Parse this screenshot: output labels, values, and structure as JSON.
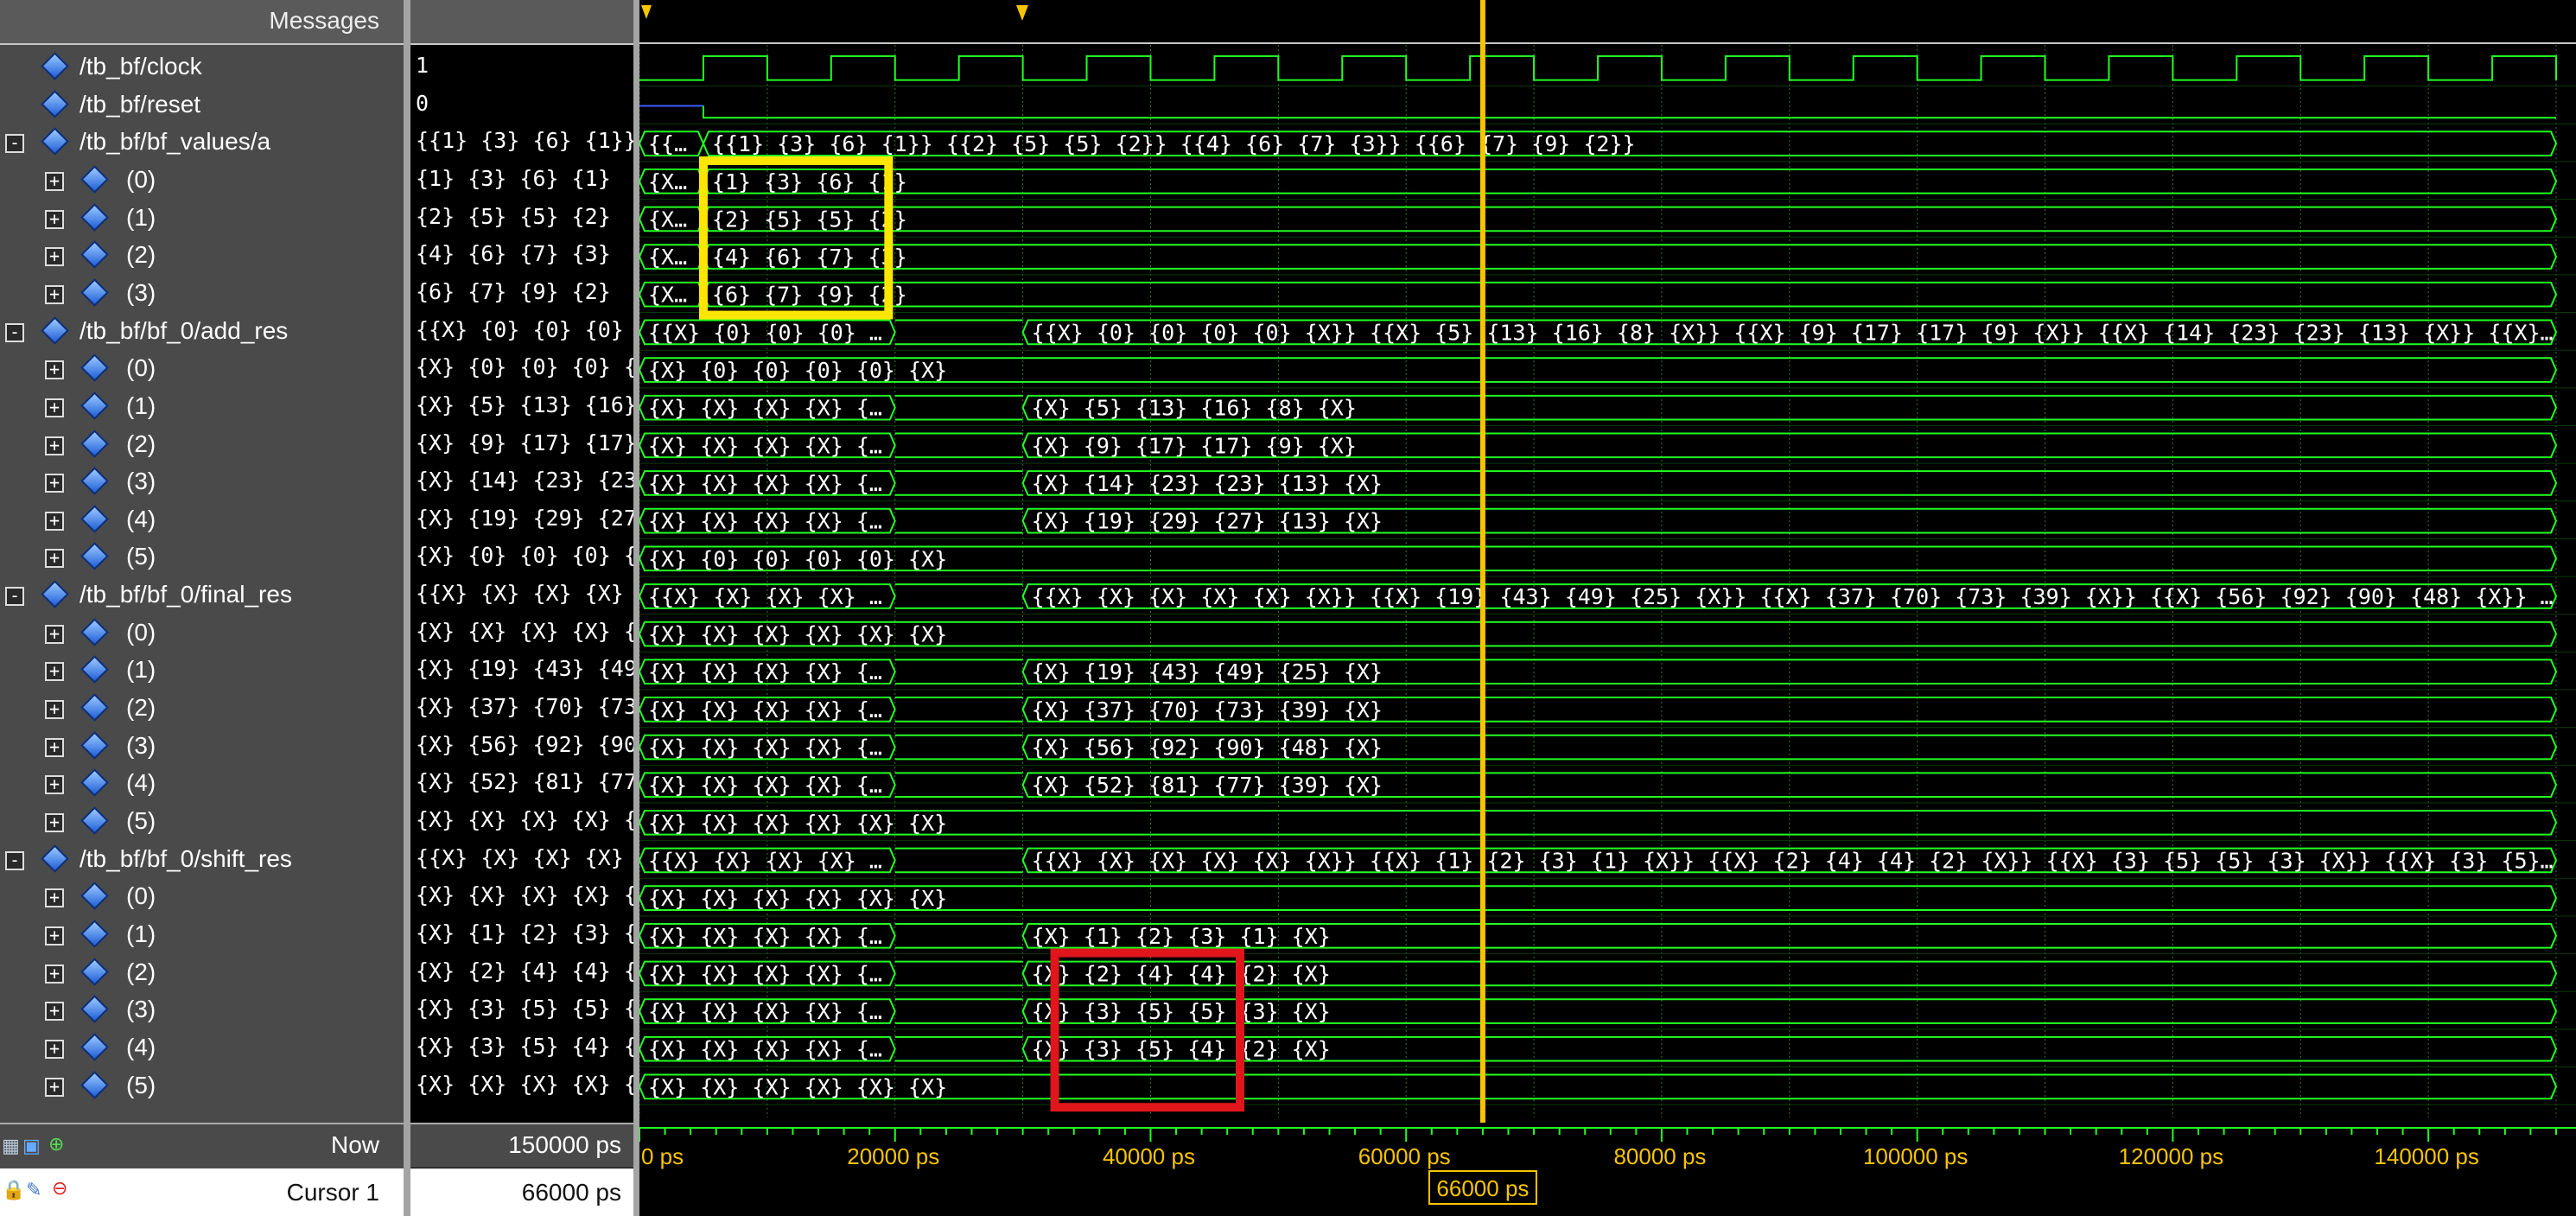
{
  "header": {
    "messages_label": "Messages"
  },
  "signals": [
    {
      "name": "/tb_bf/clock",
      "expander": "",
      "level": 0,
      "value": "1",
      "kind": "clock"
    },
    {
      "name": "/tb_bf/reset",
      "expander": "",
      "level": 0,
      "value": "0",
      "kind": "reset"
    },
    {
      "name": "/tb_bf/bf_values/a",
      "expander": "-",
      "level": 0,
      "value": "{{1} {3} {6} {1}} {{2} {5} {5} {2}} {{4} {6} {7} {3}} {{6} {7} {9} {2}}",
      "kind": "bus",
      "segments": [
        {
          "t0": 0,
          "t1": 5000,
          "text": "{{..."
        },
        {
          "t0": 5000,
          "t1": 150000,
          "text": "{{1} {3} {6} {1}} {{2} {5} {5} {2}} {{4} {6} {7} {3}} {{6} {7} {9} {2}}"
        }
      ]
    },
    {
      "name": "(0)",
      "expander": "+",
      "level": 1,
      "value": "{1} {3} {6} {1}",
      "kind": "bus",
      "segments": [
        {
          "t0": 0,
          "t1": 5000,
          "text": "{X}..."
        },
        {
          "t0": 5000,
          "t1": 150000,
          "text": "{1} {3} {6} {1}"
        }
      ]
    },
    {
      "name": "(1)",
      "expander": "+",
      "level": 1,
      "value": "{2} {5} {5} {2}",
      "kind": "bus",
      "segments": [
        {
          "t0": 0,
          "t1": 5000,
          "text": "{X}..."
        },
        {
          "t0": 5000,
          "t1": 150000,
          "text": "{2} {5} {5} {2}"
        }
      ]
    },
    {
      "name": "(2)",
      "expander": "+",
      "level": 1,
      "value": "{4} {6} {7} {3}",
      "kind": "bus",
      "segments": [
        {
          "t0": 0,
          "t1": 5000,
          "text": "{X}..."
        },
        {
          "t0": 5000,
          "t1": 150000,
          "text": "{4} {6} {7} {3}"
        }
      ]
    },
    {
      "name": "(3)",
      "expander": "+",
      "level": 1,
      "value": "{6} {7} {9} {2}",
      "kind": "bus",
      "segments": [
        {
          "t0": 0,
          "t1": 5000,
          "text": "{X}..."
        },
        {
          "t0": 5000,
          "t1": 150000,
          "text": "{6} {7} {9} {2}"
        }
      ]
    },
    {
      "name": "/tb_bf/bf_0/add_res",
      "expander": "-",
      "level": 0,
      "value": "{{X} {0} {0} {0} {0} {X}} {{X} {5} {13} {16} {8} {X}} {{X} {9} {17} {17} {9} {X}} {{X} {14} {23} {23} {13} {X}} {{X} {19} {29} {27} {13} {X}}",
      "kind": "bus",
      "segments": [
        {
          "t0": 0,
          "t1": 20000,
          "text": "{{X} {0} {0} {0} {0} {X}} {{X} {..."
        },
        {
          "t0": 30000,
          "t1": 150000,
          "text": "{{X} {0} {0} {0} {0} {X}} {{X} {5} {13} {16} {8} {X}} {{X} {9} {17} {17} {9} {X}} {{X} {14} {23} {23} {13} {X}} {{X} {19} {29} {27} {13} {..."
        }
      ]
    },
    {
      "name": "(0)",
      "expander": "+",
      "level": 1,
      "value": "{X} {0} {0} {0} {0} {X}",
      "kind": "bus",
      "segments": [
        {
          "t0": 0,
          "t1": 150000,
          "text": "{X} {0} {0} {0} {0} {X}"
        }
      ]
    },
    {
      "name": "(1)",
      "expander": "+",
      "level": 1,
      "value": "{X} {5} {13} {16} {8} {X}",
      "kind": "bus",
      "segments": [
        {
          "t0": 0,
          "t1": 20000,
          "text": "{X} {X} {X} {X} {X} {X}"
        },
        {
          "t0": 30000,
          "t1": 150000,
          "text": "{X} {5} {13} {16} {8} {X}"
        }
      ]
    },
    {
      "name": "(2)",
      "expander": "+",
      "level": 1,
      "value": "{X} {9} {17} {17} {9} {X}",
      "kind": "bus",
      "segments": [
        {
          "t0": 0,
          "t1": 20000,
          "text": "{X} {X} {X} {X} {X} {X}"
        },
        {
          "t0": 30000,
          "t1": 150000,
          "text": "{X} {9} {17} {17} {9} {X}"
        }
      ]
    },
    {
      "name": "(3)",
      "expander": "+",
      "level": 1,
      "value": "{X} {14} {23} {23} {13} {X}",
      "kind": "bus",
      "segments": [
        {
          "t0": 0,
          "t1": 20000,
          "text": "{X} {X} {X} {X} {X} {X}"
        },
        {
          "t0": 30000,
          "t1": 150000,
          "text": "{X} {14} {23} {23} {13} {X}"
        }
      ]
    },
    {
      "name": "(4)",
      "expander": "+",
      "level": 1,
      "value": "{X} {19} {29} {27} {13} {X}",
      "kind": "bus",
      "segments": [
        {
          "t0": 0,
          "t1": 20000,
          "text": "{X} {X} {X} {X} {X} {X}"
        },
        {
          "t0": 30000,
          "t1": 150000,
          "text": "{X} {19} {29} {27} {13} {X}"
        }
      ]
    },
    {
      "name": "(5)",
      "expander": "+",
      "level": 1,
      "value": "{X} {0} {0} {0} {0} {X}",
      "kind": "bus",
      "segments": [
        {
          "t0": 0,
          "t1": 150000,
          "text": "{X} {0} {0} {0} {0} {X}"
        }
      ]
    },
    {
      "name": "/tb_bf/bf_0/final_res",
      "expander": "-",
      "level": 0,
      "value": "{{X} {X} {X} {X} {X} {X}} {{X} {19} {43} {49} {25} {X}} {{X} {37} {70} {73} {39} {X}} {{X} {56} {92} {90} {48} {X}} {{X} {52} {81} {77} {39} {X}}",
      "kind": "bus",
      "segments": [
        {
          "t0": 0,
          "t1": 20000,
          "text": "{{X} {X} {X} {X} {X} {X}} {{X} {..."
        },
        {
          "t0": 30000,
          "t1": 150000,
          "text": "{{X} {X} {X} {X} {X} {X}} {{X} {19} {43} {49} {25} {X}} {{X} {37} {70} {73} {39} {X}} {{X} {56} {92} {90} {48} {X}} {{X} {52} {81} {77} {..."
        }
      ]
    },
    {
      "name": "(0)",
      "expander": "+",
      "level": 1,
      "value": "{X} {X} {X} {X} {X} {X}",
      "kind": "bus",
      "segments": [
        {
          "t0": 0,
          "t1": 150000,
          "text": "{X} {X} {X} {X} {X} {X}"
        }
      ]
    },
    {
      "name": "(1)",
      "expander": "+",
      "level": 1,
      "value": "{X} {19} {43} {49} {25} {X}",
      "kind": "bus",
      "segments": [
        {
          "t0": 0,
          "t1": 20000,
          "text": "{X} {X} {X} {X} {X} {X}"
        },
        {
          "t0": 30000,
          "t1": 150000,
          "text": "{X} {19} {43} {49} {25} {X}"
        }
      ]
    },
    {
      "name": "(2)",
      "expander": "+",
      "level": 1,
      "value": "{X} {37} {70} {73} {39} {X}",
      "kind": "bus",
      "segments": [
        {
          "t0": 0,
          "t1": 20000,
          "text": "{X} {X} {X} {X} {X} {X}"
        },
        {
          "t0": 30000,
          "t1": 150000,
          "text": "{X} {37} {70} {73} {39} {X}"
        }
      ]
    },
    {
      "name": "(3)",
      "expander": "+",
      "level": 1,
      "value": "{X} {56} {92} {90} {48} {X}",
      "kind": "bus",
      "segments": [
        {
          "t0": 0,
          "t1": 20000,
          "text": "{X} {X} {X} {X} {X} {X}"
        },
        {
          "t0": 30000,
          "t1": 150000,
          "text": "{X} {56} {92} {90} {48} {X}"
        }
      ]
    },
    {
      "name": "(4)",
      "expander": "+",
      "level": 1,
      "value": "{X} {52} {81} {77} {39} {X}",
      "kind": "bus",
      "segments": [
        {
          "t0": 0,
          "t1": 20000,
          "text": "{X} {X} {X} {X} {X} {X}"
        },
        {
          "t0": 30000,
          "t1": 150000,
          "text": "{X} {52} {81} {77} {39} {X}"
        }
      ]
    },
    {
      "name": "(5)",
      "expander": "+",
      "level": 1,
      "value": "{X} {X} {X} {X} {X} {X}",
      "kind": "bus",
      "segments": [
        {
          "t0": 0,
          "t1": 150000,
          "text": "{X} {X} {X} {X} {X} {X}"
        }
      ]
    },
    {
      "name": "/tb_bf/bf_0/shift_res",
      "expander": "-",
      "level": 0,
      "value": "{{X} {X} {X} {X} {X} {X}} {{X} {1} {2} {3} {1} {X}} {{X} {2} {4} {4} {2} {X}} {{X} {3} {5} {5} {3} {X}} {{X} {3} {5} {4} {2} {X}}",
      "kind": "bus",
      "segments": [
        {
          "t0": 0,
          "t1": 20000,
          "text": "{{X} {X} {X} {X} {X} {X}} {{X} {..."
        },
        {
          "t0": 30000,
          "t1": 150000,
          "text": "{{X} {X} {X} {X} {X} {X}} {{X} {1} {2} {3} {1} {X}} {{X} {2} {4} {4} {2} {X}} {{X} {3} {5} {5} {3} {X}} {{X} {3} {5} {4} {2} {X}} {{X} {X} {..."
        }
      ]
    },
    {
      "name": "(0)",
      "expander": "+",
      "level": 1,
      "value": "{X} {X} {X} {X} {X} {X}",
      "kind": "bus",
      "segments": [
        {
          "t0": 0,
          "t1": 150000,
          "text": "{X} {X} {X} {X} {X} {X}"
        }
      ]
    },
    {
      "name": "(1)",
      "expander": "+",
      "level": 1,
      "value": "{X} {1} {2} {3} {1} {X}",
      "kind": "bus",
      "segments": [
        {
          "t0": 0,
          "t1": 20000,
          "text": "{X} {X} {X} {X} {X} {X}"
        },
        {
          "t0": 30000,
          "t1": 150000,
          "text": "{X} {1} {2} {3} {1} {X}"
        }
      ]
    },
    {
      "name": "(2)",
      "expander": "+",
      "level": 1,
      "value": "{X} {2} {4} {4} {2} {X}",
      "kind": "bus",
      "segments": [
        {
          "t0": 0,
          "t1": 20000,
          "text": "{X} {X} {X} {X} {X} {X}"
        },
        {
          "t0": 30000,
          "t1": 150000,
          "text": "{X} {2} {4} {4} {2} {X}"
        }
      ]
    },
    {
      "name": "(3)",
      "expander": "+",
      "level": 1,
      "value": "{X} {3} {5} {5} {3} {X}",
      "kind": "bus",
      "segments": [
        {
          "t0": 0,
          "t1": 20000,
          "text": "{X} {X} {X} {X} {X} {X}"
        },
        {
          "t0": 30000,
          "t1": 150000,
          "text": "{X} {3} {5} {5} {3} {X}"
        }
      ]
    },
    {
      "name": "(4)",
      "expander": "+",
      "level": 1,
      "value": "{X} {3} {5} {4} {2} {X}",
      "kind": "bus",
      "segments": [
        {
          "t0": 0,
          "t1": 20000,
          "text": "{X} {X} {X} {X} {X} {X}"
        },
        {
          "t0": 30000,
          "t1": 150000,
          "text": "{X} {3} {5} {4} {2} {X}"
        }
      ]
    },
    {
      "name": "(5)",
      "expander": "+",
      "level": 1,
      "value": "{X} {X} {X} {X} {X} {X}",
      "kind": "bus",
      "segments": [
        {
          "t0": 0,
          "t1": 150000,
          "text": "{X} {X} {X} {X} {X} {X}"
        }
      ]
    }
  ],
  "timeline": {
    "time_range_ps": [
      0,
      150000
    ],
    "clock_period_ps": 10000,
    "reset_release_ps": 5000,
    "tick_labels": [
      "0 ps",
      "20000 ps",
      "40000 ps",
      "60000 ps",
      "80000 ps",
      "100000 ps",
      "120000 ps",
      "140000 ps"
    ],
    "cursor_time_ps": 66000,
    "cursor_label": "66000 ps"
  },
  "footer": {
    "now_label": "Now",
    "now_value": "150000 ps",
    "cursor_name": "Cursor 1",
    "cursor_value": "66000 ps"
  },
  "highlights": [
    {
      "color": "#ffe600",
      "t0": 5000,
      "t1": 19500,
      "rows": [
        3,
        6
      ]
    },
    {
      "color": "#e0161c",
      "t0": 32500,
      "t1": 47000,
      "rows": [
        24,
        27
      ]
    }
  ],
  "colors": {
    "wave": "#22ff22",
    "cursor": "#f7c400",
    "reset_low": "#3a5bff",
    "background": "#000000",
    "panel_bg": "#4a4a4a"
  }
}
